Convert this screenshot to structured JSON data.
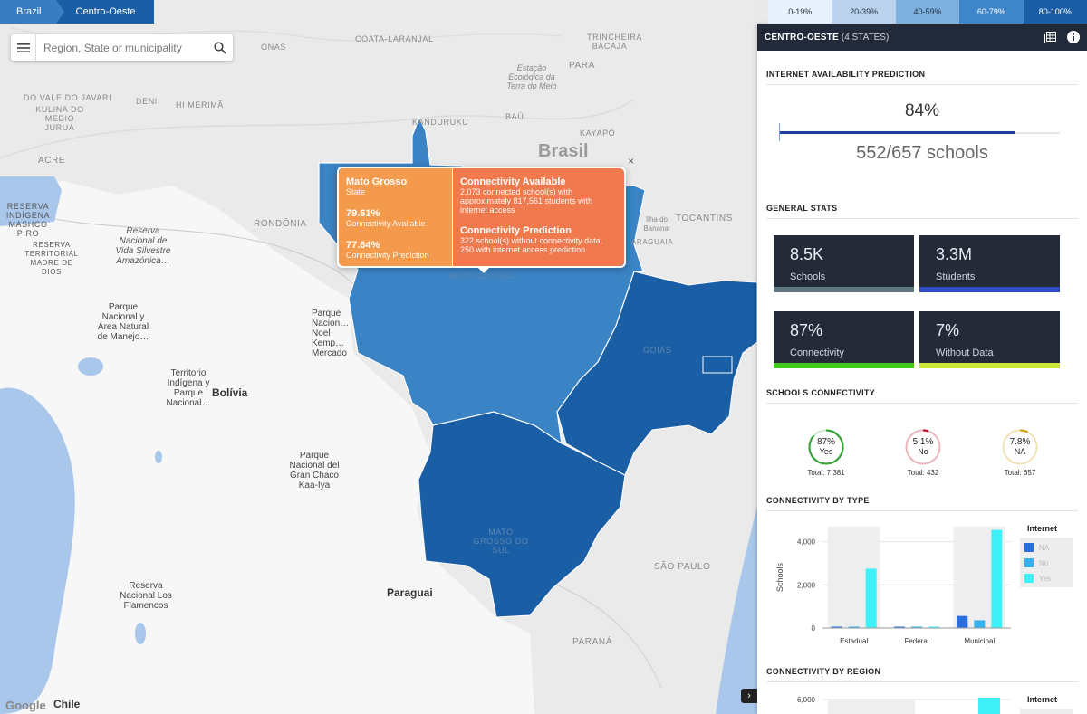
{
  "breadcrumb": {
    "country": "Brazil",
    "region": "Centro-Oeste"
  },
  "legend": [
    {
      "label": "0-19%",
      "color": "#e8f0fb"
    },
    {
      "label": "20-39%",
      "color": "#bcd3ee"
    },
    {
      "label": "40-59%",
      "color": "#7fb1e0"
    },
    {
      "label": "60-79%",
      "color": "#3f86c9"
    },
    {
      "label": "80-100%",
      "color": "#1a5ea6"
    }
  ],
  "search": {
    "placeholder": "Region, State or municipality"
  },
  "map_labels": {
    "acre": "ACRE",
    "rondonia": "RONDÔNIA",
    "tocantins": "TOCANTINS",
    "goias": "GOIÁS",
    "mato_grosso": "MATO GROSSO",
    "mato_grosso_do_sul": "MATO GROSSO DO SUL",
    "sao_paulo": "SÃO PAULO",
    "parana": "PARANÁ",
    "para": "PARÁ",
    "brasil": "Brasil",
    "bolivia": "Bolívia",
    "paraguai": "Paraguai",
    "chile": "Chile",
    "coata": "COATA-LARANJAL",
    "trincheira": "TRINCHEIRA BACAJA",
    "kulina": "KULINA DO MEDIO JURUA",
    "deni": "DENI",
    "hi_merima": "HI MERIMÃ",
    "kanduruku": "KANDURUKU",
    "kayapo": "KAYAPÓ",
    "bau": "BAÚ",
    "vale_javari": "DO VALE DO JAVARI",
    "onas": "ONAS",
    "estacao": "Estação Ecológica da Terra do Meio",
    "reserva_indigena": "RESERVA INDÍGENA MASHCO PIRO",
    "reserva_territorial": "RESERVA TERRITORIAL MADRE DE DIOS",
    "reserva_vida": "Reserva Nacional de Vida Silvestre Amazónica…",
    "parque_area": "Parque Nacional y Área Natural de Manejo…",
    "territorio": "Territorio Indígena y Parque Nacional…",
    "parque_noel": "Parque Nacion… Noel Kemp… Mercado",
    "parque_chaco": "Parque Nacional del Gran Chaco Kaa-Iya",
    "reserva_flamencos": "Reserva Nacional Los Flamencos",
    "ilha_bananal": "Ilha do Bananal",
    "araguaia": "ARAGUAIA",
    "mato_grosso_small": "MATO GROSSO"
  },
  "tooltip": {
    "state_name": "Mato Grosso",
    "state_type": "State",
    "pct_available": "79.61%",
    "pct_available_label": "Connectivity Available",
    "pct_prediction": "77.64%",
    "pct_prediction_label": "Connectivity Prediction",
    "available_title": "Connectivity Available",
    "available_text": "2,073 connected school(s) with approximately 817,561 students with internet access",
    "prediction_title": "Connectivity Prediction",
    "prediction_text": "322 school(s) without connectivity data, 250 with internet access prediction",
    "close": "×"
  },
  "map_footer": {
    "google": "Google",
    "expand": "›"
  },
  "panel": {
    "title": "CENTRO-OESTE",
    "subtitle": "(4 STATES)",
    "icons": [
      "table-icon",
      "info-icon"
    ],
    "availability": {
      "heading": "INTERNET AVAILABILITY PREDICTION",
      "percent": "84%",
      "fraction": 0.84,
      "schools": "552/657 schools"
    },
    "general": {
      "heading": "GENERAL STATS",
      "cards": [
        {
          "value": "8.5K",
          "label": "Schools",
          "color": "#5f7582"
        },
        {
          "value": "3.3M",
          "label": "Students",
          "color": "#2f4bc0"
        },
        {
          "value": "87%",
          "label": "Connectivity",
          "color": "#45c81e"
        },
        {
          "value": "7%",
          "label": "Without Data",
          "color": "#cde835"
        }
      ]
    },
    "schools_connectivity": {
      "heading": "SCHOOLS CONNECTIVITY",
      "items": [
        {
          "pct": "87%",
          "label": "Yes",
          "total": "Total: 7,381",
          "value": 0.87,
          "color": "#3aa33a",
          "track": "#cfe8cf"
        },
        {
          "pct": "5.1%",
          "label": "No",
          "total": "Total: 432",
          "value": 0.051,
          "color": "#c8102e",
          "track": "#e9b5bc"
        },
        {
          "pct": "7.8%",
          "label": "NA",
          "total": "Total: 657",
          "value": 0.078,
          "color": "#d4a017",
          "track": "#f0e2b5"
        }
      ]
    },
    "by_type": {
      "heading": "CONNECTIVITY BY TYPE"
    },
    "by_region": {
      "heading": "CONNECTIVITY BY REGION"
    }
  },
  "chart_data": [
    {
      "type": "bar",
      "title": "CONNECTIVITY BY TYPE",
      "categories": [
        "Estadual",
        "Federal",
        "Municipal"
      ],
      "series": [
        {
          "name": "NA",
          "values": [
            60,
            0,
            560
          ],
          "color": "#2a6fe0"
        },
        {
          "name": "No",
          "values": [
            50,
            0,
            360
          ],
          "color": "#37b1ee"
        },
        {
          "name": "Yes",
          "values": [
            2750,
            60,
            4550
          ],
          "color": "#3ff0f8"
        }
      ],
      "ylabel": "Schools",
      "yticks": [
        "0",
        "2,000",
        "4,000"
      ],
      "ylim": [
        0,
        4700
      ],
      "legend_title": "Internet",
      "legend": "right"
    },
    {
      "type": "bar",
      "title": "CONNECTIVITY BY REGION",
      "yticks": [
        "6,000"
      ],
      "legend_title": "Internet",
      "legend": "right"
    }
  ]
}
